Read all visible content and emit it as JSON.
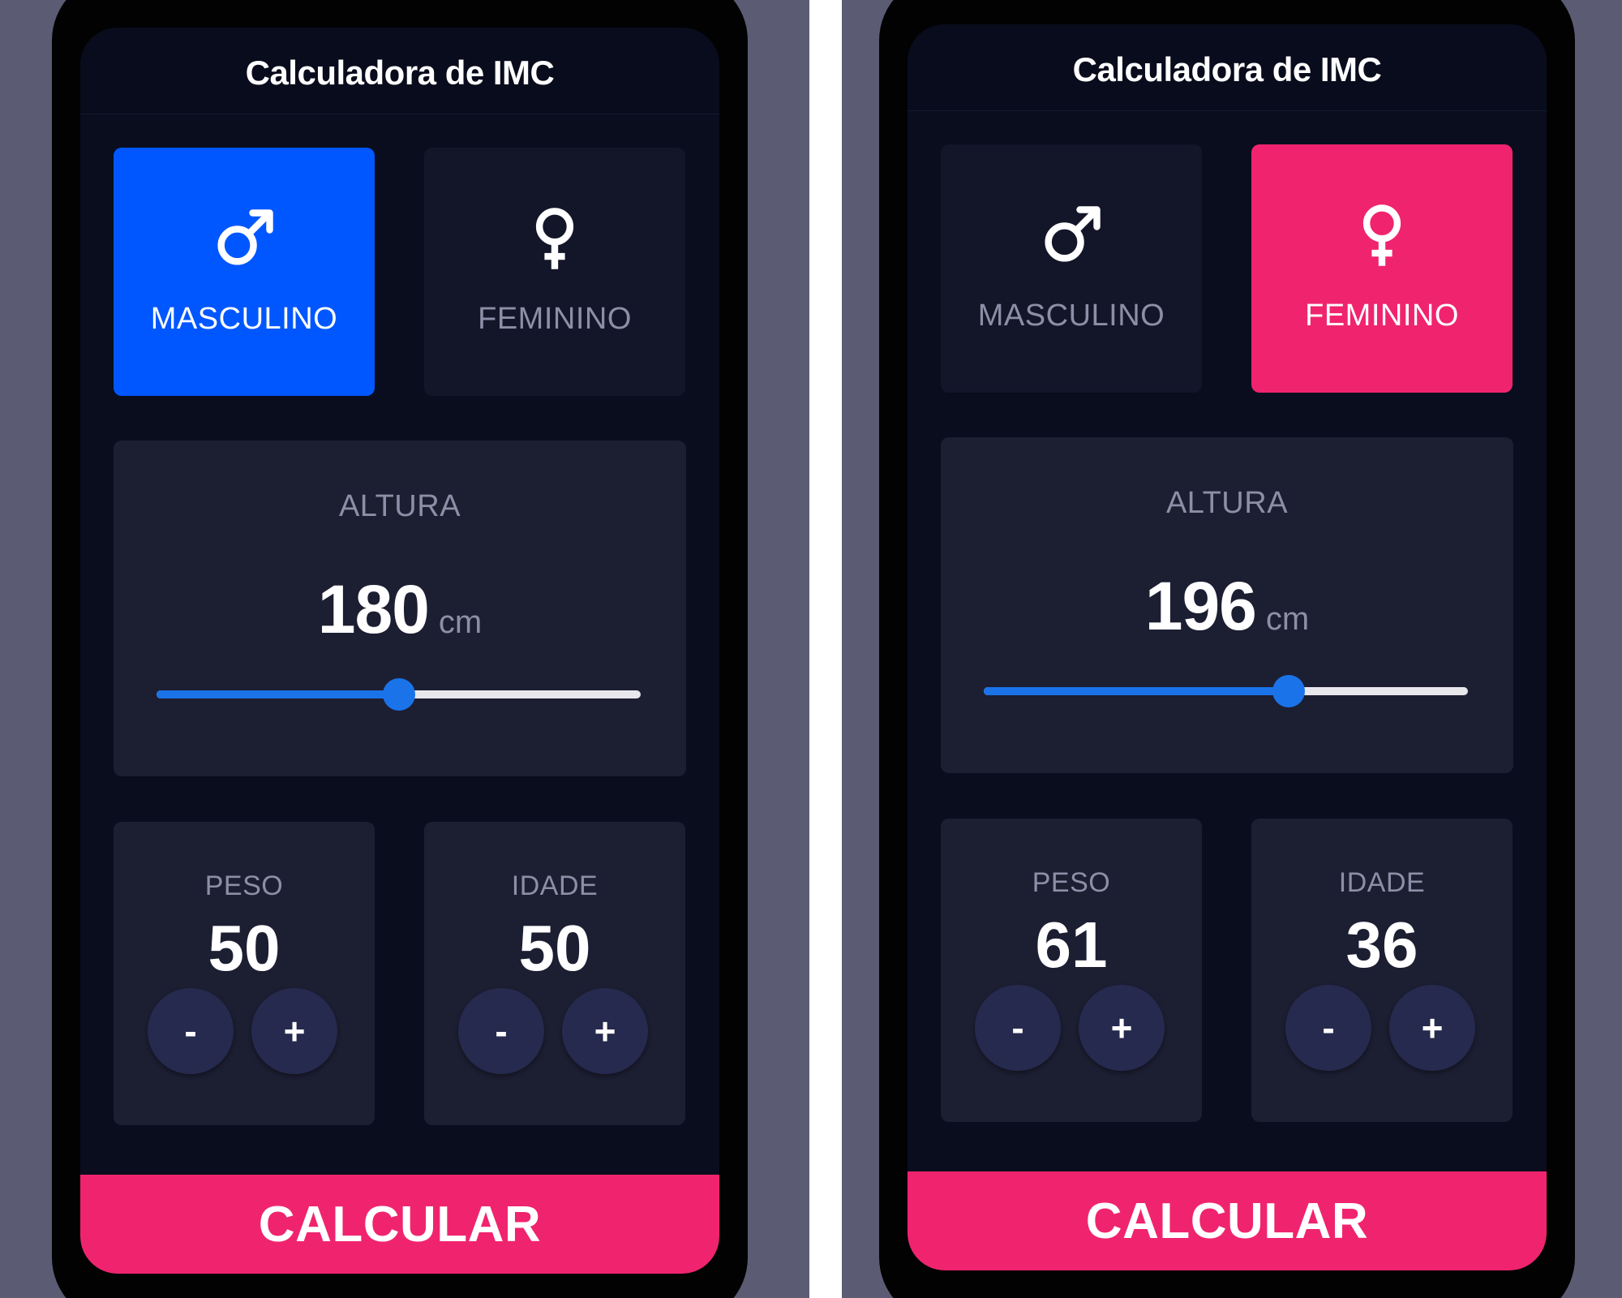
{
  "panels": [
    {
      "title": "Calculadora de IMC",
      "selected_gender": "male",
      "gender": {
        "male": {
          "symbol": "male-symbol-icon",
          "label": "MASCULINO"
        },
        "female": {
          "symbol": "female-symbol-icon",
          "label": "FEMININO"
        }
      },
      "height": {
        "label": "ALTURA",
        "value": "180",
        "unit": "cm",
        "slider_fraction": 0.5
      },
      "weight": {
        "label": "PESO",
        "value": "50",
        "minus": "-",
        "plus": "+"
      },
      "age": {
        "label": "IDADE",
        "value": "50",
        "minus": "-",
        "plus": "+"
      },
      "calculate_label": "CALCULAR"
    },
    {
      "title": "Calculadora de IMC",
      "selected_gender": "female",
      "gender": {
        "male": {
          "symbol": "male-symbol-icon",
          "label": "MASCULINO"
        },
        "female": {
          "symbol": "female-symbol-icon",
          "label": "FEMININO"
        }
      },
      "height": {
        "label": "ALTURA",
        "value": "196",
        "unit": "cm",
        "slider_fraction": 0.63
      },
      "weight": {
        "label": "PESO",
        "value": "61",
        "minus": "-",
        "plus": "+"
      },
      "age": {
        "label": "IDADE",
        "value": "36",
        "minus": "-",
        "plus": "+"
      },
      "calculate_label": "CALCULAR"
    }
  ],
  "colors": {
    "male_accent": "#0057ff",
    "female_accent": "#f0246e",
    "slider": "#1a73e8",
    "background": "#0a0d1e",
    "card": "#1c1e32",
    "outer_background": "#5b5c74"
  }
}
